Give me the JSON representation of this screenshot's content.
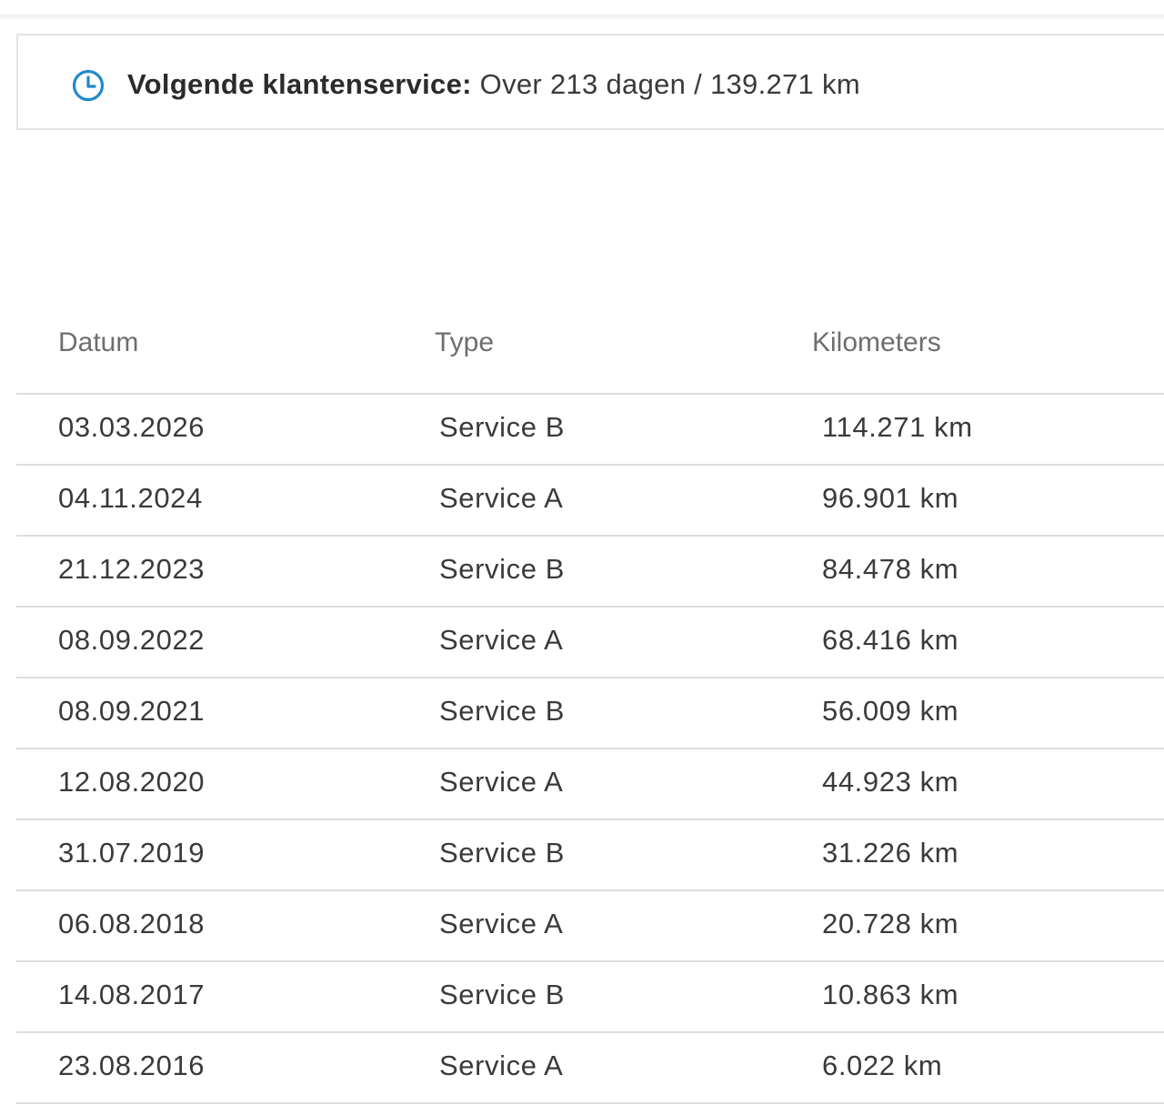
{
  "banner": {
    "icon": "clock-icon",
    "accent_color": "#1f8acb",
    "label": "Volgende klantenservice:",
    "value": " Over 213 dagen / 139.271 km"
  },
  "table": {
    "columns": [
      "Datum",
      "Type",
      "Kilometers"
    ],
    "rows": [
      {
        "date": "03.03.2026",
        "type": "Service B",
        "km": "114.271 km"
      },
      {
        "date": "04.11.2024",
        "type": "Service A",
        "km": "96.901 km"
      },
      {
        "date": "21.12.2023",
        "type": "Service B",
        "km": "84.478 km"
      },
      {
        "date": "08.09.2022",
        "type": "Service A",
        "km": "68.416 km"
      },
      {
        "date": "08.09.2021",
        "type": "Service B",
        "km": "56.009 km"
      },
      {
        "date": "12.08.2020",
        "type": "Service A",
        "km": "44.923 km"
      },
      {
        "date": "31.07.2019",
        "type": "Service B",
        "km": "31.226 km"
      },
      {
        "date": "06.08.2018",
        "type": "Service A",
        "km": "20.728 km"
      },
      {
        "date": "14.08.2017",
        "type": "Service B",
        "km": "10.863 km"
      },
      {
        "date": "23.08.2016",
        "type": "Service A",
        "km": "6.022 km"
      }
    ]
  }
}
